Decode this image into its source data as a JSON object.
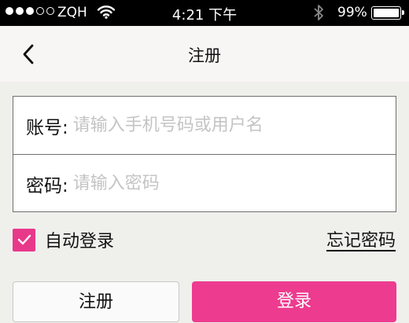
{
  "status_bar": {
    "signal_dots": [
      true,
      true,
      true,
      false,
      false
    ],
    "carrier": "ZQH",
    "wifi_icon": "wifi-icon",
    "time": "4:21 下午",
    "bluetooth_icon": "bluetooth-icon",
    "battery_percent": "99%",
    "battery_level": 0.99
  },
  "nav": {
    "back_icon": "chevron-left-icon",
    "title": "注册"
  },
  "form": {
    "account_label": "账号:",
    "account_placeholder": "请输入手机号码或用户名",
    "account_value": "",
    "password_label": "密码:",
    "password_placeholder": "请输入密码",
    "password_value": ""
  },
  "options": {
    "auto_login_label": "自动登录",
    "auto_login_checked": true,
    "forgot_password": "忘记密码"
  },
  "buttons": {
    "register": "注册",
    "login": "登录"
  },
  "colors": {
    "accent": "#ed3b8f",
    "status_bar_bg": "#000000",
    "nav_bg": "#f8f5f5",
    "page_bg": "#efefec"
  }
}
